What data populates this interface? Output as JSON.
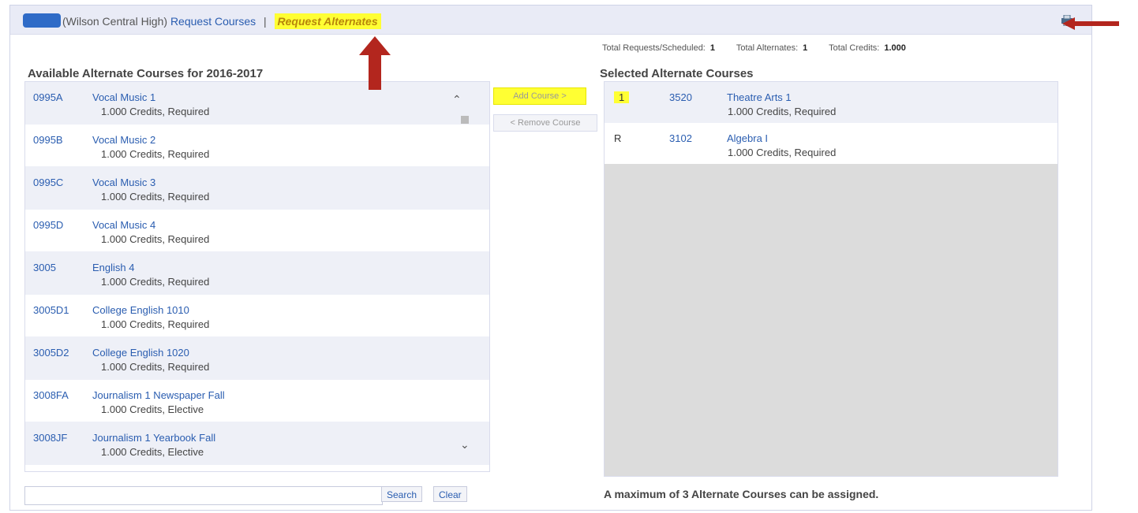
{
  "header": {
    "school": "(Wilson Central High)",
    "request_courses": "Request Courses",
    "separator": "|",
    "request_alternates": "Request Alternates"
  },
  "totals": {
    "requests_label": "Total Requests/Scheduled:",
    "requests_value": "1",
    "alternates_label": "Total Alternates:",
    "alternates_value": "1",
    "credits_label": "Total Credits:",
    "credits_value": "1.000"
  },
  "left": {
    "title": "Available Alternate Courses for 2016-2017",
    "courses": [
      {
        "code": "0995A",
        "name": "Vocal Music 1",
        "meta": "1.000 Credits,  Required"
      },
      {
        "code": "0995B",
        "name": "Vocal Music 2",
        "meta": "1.000 Credits,  Required"
      },
      {
        "code": "0995C",
        "name": "Vocal Music 3",
        "meta": "1.000 Credits,  Required"
      },
      {
        "code": "0995D",
        "name": "Vocal Music 4",
        "meta": "1.000 Credits,  Required"
      },
      {
        "code": "3005",
        "name": "English 4",
        "meta": "1.000 Credits,  Required"
      },
      {
        "code": "3005D1",
        "name": "College English 1010",
        "meta": "1.000 Credits,  Required"
      },
      {
        "code": "3005D2",
        "name": "College English 1020",
        "meta": "1.000 Credits,  Required"
      },
      {
        "code": "3008FA",
        "name": "Journalism 1 Newspaper Fall",
        "meta": "1.000 Credits,  Elective"
      },
      {
        "code": "3008JF",
        "name": "Journalism 1 Yearbook Fall",
        "meta": "1.000 Credits,  Elective"
      }
    ]
  },
  "actions": {
    "add": "Add Course >",
    "remove": "< Remove Course"
  },
  "right": {
    "title": "Selected Alternate Courses",
    "selected": [
      {
        "flag": "1",
        "code": "3520",
        "name": "Theatre Arts 1",
        "meta": "1.000 Credits,  Required"
      },
      {
        "flag": "R",
        "code": "3102",
        "name": "Algebra I",
        "meta": "1.000 Credits,  Required"
      }
    ],
    "max_note": "A maximum of 3 Alternate Courses can be assigned."
  },
  "search": {
    "placeholder": "",
    "search_button": "Search",
    "clear_button": "Clear"
  }
}
